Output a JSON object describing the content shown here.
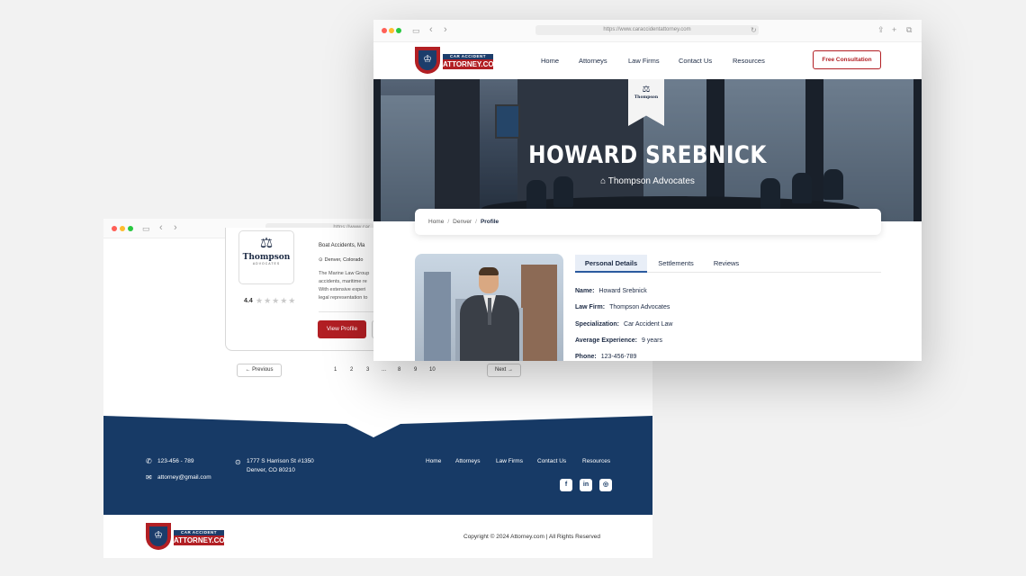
{
  "back_window": {
    "url": "https://www.car",
    "card": {
      "logo_brand": "Thompson",
      "logo_sub": "ADVOCATES",
      "practice_areas": "Boat Accidents, Ma",
      "location": "Denver, Colorado",
      "description_lines": [
        "The Marine Law Group",
        "accidents, maritime re",
        "With extensive experi",
        "legal representation to"
      ],
      "rating": "4.4",
      "stars": "★★★★★",
      "rating_value": 4.4,
      "view_profile_label": "View Profile"
    },
    "pagination": {
      "previous_label": "Previous",
      "pages": [
        "1",
        "2",
        "3",
        "...",
        "8",
        "9",
        "10"
      ],
      "next_label": "Next"
    },
    "footer": {
      "phone": "123-456 - 789",
      "email": "attorney@gmail.com",
      "address_line1": "1777 S Harrison St #1350",
      "address_line2": "Denver, CO 80210",
      "links": [
        "Home",
        "Attorneys",
        "Law Firms",
        "Contact Us",
        "Resources"
      ],
      "social": [
        "f",
        "in",
        "◎"
      ],
      "copyright": "Copyright © 2024 Attorney.com | All Rights Reserved"
    }
  },
  "front_window": {
    "url": "https://www.caraccidentattorney.com",
    "logo": {
      "line1": "CAR ACCIDENT",
      "line2": "ATTORNEY.COM"
    },
    "nav": [
      "Home",
      "Attorneys",
      "Law Firms",
      "Contact Us",
      "Resources"
    ],
    "cta_label": "Free Consultation",
    "hero": {
      "ribbon_brand": "Thompson",
      "name": "HOWARD SREBNICK",
      "firm": "Thompson Advocates"
    },
    "breadcrumb": {
      "home": "Home",
      "city": "Denver",
      "current": "Profile"
    },
    "tabs": [
      "Personal Details",
      "Settlements",
      "Reviews"
    ],
    "details": [
      {
        "label": "Name:",
        "value": "Howard Srebnick"
      },
      {
        "label": "Law Firm:",
        "value": "Thompson Advocates"
      },
      {
        "label": "Specialization:",
        "value": "Car Accident Law"
      },
      {
        "label": "Average Experience:",
        "value": "9 years"
      },
      {
        "label": "Phone:",
        "value": "123-456-789"
      }
    ]
  },
  "colors": {
    "navy": "#173a66",
    "red": "#b21f24",
    "background": "#f2f2f2"
  },
  "icons": [
    "search-icon",
    "sidebar-icon",
    "chevron-left-icon",
    "chevron-right-icon",
    "share-icon",
    "plus-icon",
    "tabs-icon",
    "phone-icon",
    "mail-icon",
    "location-pin-icon",
    "facebook-icon",
    "linkedin-icon",
    "instagram-icon",
    "scales-icon",
    "building-icon",
    "star-icon"
  ]
}
